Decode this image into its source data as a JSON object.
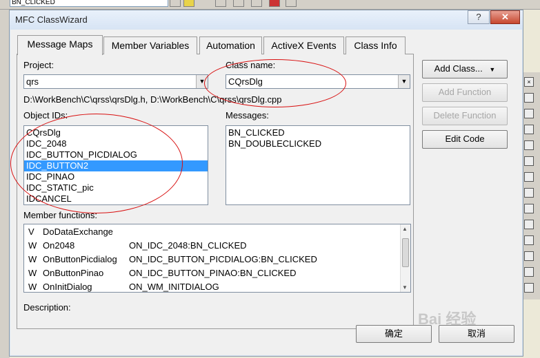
{
  "background": {
    "toolbar_combo_value": "BN_CLICKED"
  },
  "dialog": {
    "title": "MFC ClassWizard",
    "help_glyph": "?",
    "close_glyph": "✕",
    "tabs": [
      "Message Maps",
      "Member Variables",
      "Automation",
      "ActiveX Events",
      "Class Info"
    ],
    "project_label": "Project:",
    "project_value": "qrs",
    "class_name_label": "Class name:",
    "class_name_value": "CQrsDlg",
    "file_path": "D:\\WorkBench\\C\\qrss\\qrsDlg.h, D:\\WorkBench\\C\\qrss\\qrsDlg.cpp",
    "object_ids_label": "Object IDs:",
    "object_ids": [
      "CQrsDlg",
      "IDC_2048",
      "IDC_BUTTON_PICDIALOG",
      "IDC_BUTTON2",
      "IDC_PINAO",
      "IDC_STATIC_pic",
      "IDCANCEL"
    ],
    "object_ids_selected": "IDC_BUTTON2",
    "messages_label": "Messages:",
    "messages": [
      "BN_CLICKED",
      "BN_DOUBLECLICKED"
    ],
    "member_functions_label": "Member functions:",
    "member_functions": [
      {
        "flag": "V",
        "name": "DoDataExchange",
        "map": ""
      },
      {
        "flag": "W",
        "name": "On2048",
        "map": "ON_IDC_2048:BN_CLICKED"
      },
      {
        "flag": "W",
        "name": "OnButtonPicdialog",
        "map": "ON_IDC_BUTTON_PICDIALOG:BN_CLICKED"
      },
      {
        "flag": "W",
        "name": "OnButtonPinao",
        "map": "ON_IDC_BUTTON_PINAO:BN_CLICKED"
      },
      {
        "flag": "W",
        "name": "OnInitDialog",
        "map": "ON_WM_INITDIALOG"
      }
    ],
    "description_label": "Description:",
    "buttons": {
      "add_class": "Add Class...",
      "add_function": "Add Function",
      "delete_function": "Delete Function",
      "edit_code": "Edit Code",
      "ok": "确定",
      "cancel": "取消"
    }
  },
  "watermark": "Bai 经验",
  "colors": {
    "selection": "#3399ff",
    "annotation": "#d80f0f"
  }
}
